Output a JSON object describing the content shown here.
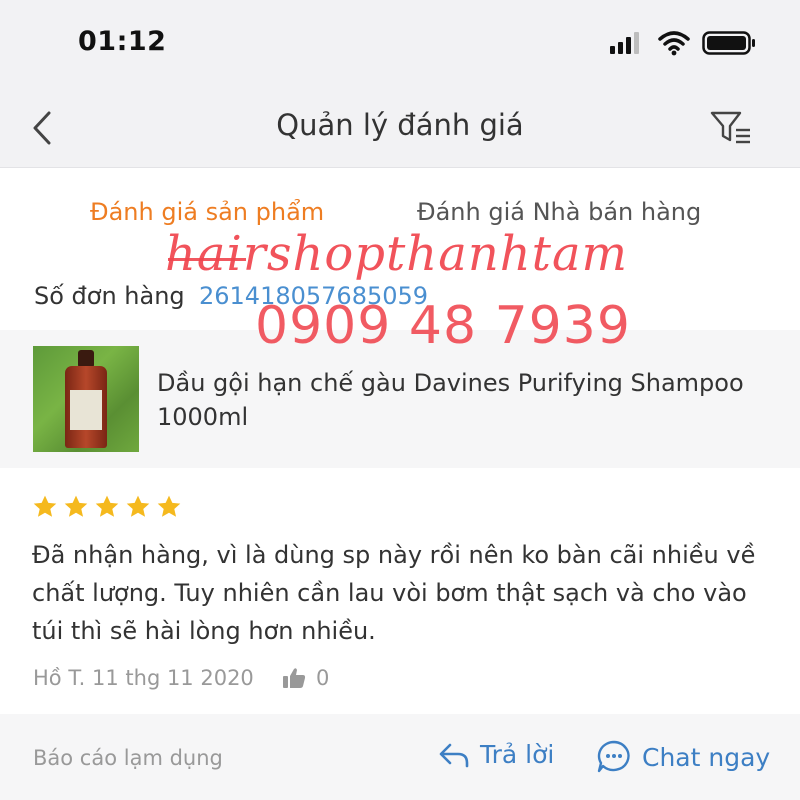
{
  "status_bar": {
    "time": "01:12",
    "icons": [
      "signal-icon",
      "wifi-icon",
      "battery-icon"
    ]
  },
  "header": {
    "title": "Quản lý đánh giá",
    "back_icon": "chevron-left-icon",
    "filter_icon": "filter-list-icon"
  },
  "tabs": [
    {
      "label": "Đánh giá sản phẩm",
      "active": true
    },
    {
      "label": "Đánh giá Nhà bán hàng",
      "active": false
    }
  ],
  "order": {
    "label": "Số đơn hàng",
    "number": "261418057685059"
  },
  "product": {
    "name": "Dầu gội hạn chế gàu Davines Purifying Shampoo 1000ml",
    "thumbnail_icon": "product-bottle-image"
  },
  "review": {
    "rating": 5,
    "rating_max": 5,
    "text": "Đã nhận hàng, vì là dùng sp này rồi nên ko bàn cãi nhiều về chất lượng. Tuy nhiên cần lau vòi bơm thật sạch và cho vào túi thì sẽ hài lòng hơn nhiều.",
    "author_date": "Hồ T. 11 thg 11 2020",
    "like_count": "0"
  },
  "actions": {
    "report_label": "Báo cáo lạm dụng",
    "reply_label": "Trả lời",
    "chat_label": "Chat ngay"
  },
  "watermark": {
    "line1": "hairshopthanhtam",
    "line2": "0909 48 7939"
  },
  "colors": {
    "accent_orange": "#ee7d22",
    "link_blue": "#4a8fd0",
    "star_yellow": "#f5b91e",
    "watermark_red": "#f0454e"
  }
}
